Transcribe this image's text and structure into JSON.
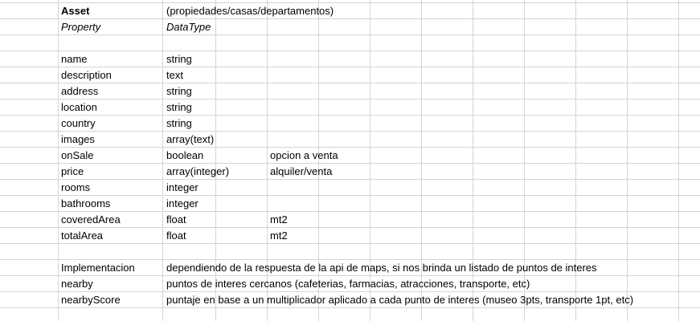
{
  "sheet": {
    "asset_label": "Asset",
    "asset_value": "(propiedades/casas/departamentos)",
    "property_header": "Property",
    "datatype_header": "DataType",
    "rows": [
      {
        "name": "name",
        "type": "string",
        "note": ""
      },
      {
        "name": "description",
        "type": "text",
        "note": ""
      },
      {
        "name": "address",
        "type": "string",
        "note": ""
      },
      {
        "name": "location",
        "type": "string",
        "note": ""
      },
      {
        "name": "country",
        "type": "string",
        "note": ""
      },
      {
        "name": "images",
        "type": "array(text)",
        "note": ""
      },
      {
        "name": "onSale",
        "type": "boolean",
        "note": "opcion a venta"
      },
      {
        "name": "price",
        "type": "array(integer)",
        "note": "alquiler/venta"
      },
      {
        "name": "rooms",
        "type": "integer",
        "note": ""
      },
      {
        "name": "bathrooms",
        "type": "integer",
        "note": ""
      },
      {
        "name": "coveredArea",
        "type": "float",
        "note": "mt2"
      },
      {
        "name": "totalArea",
        "type": "float",
        "note": "mt2"
      }
    ],
    "notes": [
      {
        "label": "Implementacion",
        "text": "dependiendo de la respuesta de la api de maps, si nos brinda un listado de puntos de interes"
      },
      {
        "label": "nearby",
        "text": "puntos de interes cercanos (cafeterias, farmacias, atracciones, transporte, etc)"
      },
      {
        "label": "nearbyScore",
        "text": "puntaje en base a un multiplicador aplicado a cada punto de interes (museo 3pts, transporte 1pt, etc)"
      }
    ]
  }
}
